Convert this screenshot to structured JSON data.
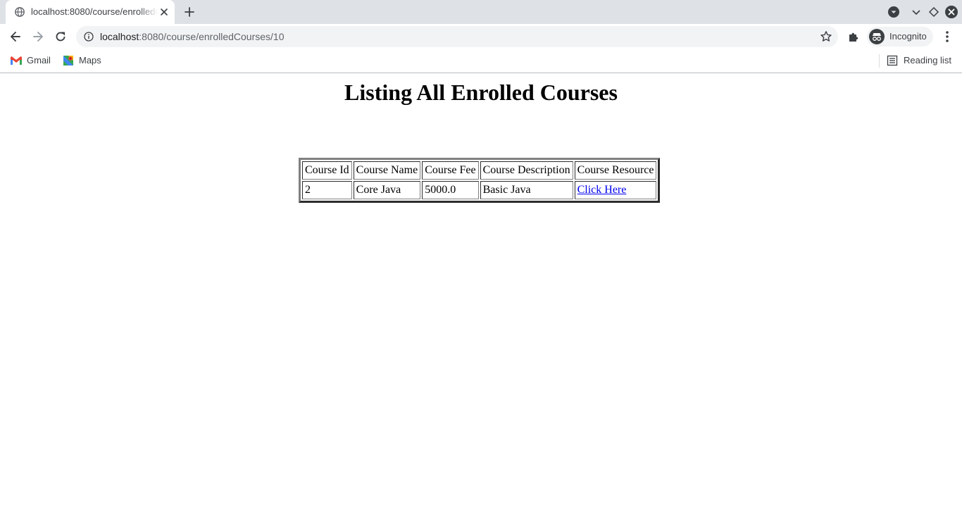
{
  "browser": {
    "tab_title": "localhost:8080/course/enrolledCourses/10",
    "url_host": "localhost",
    "url_path": ":8080/course/enrolledCourses/10",
    "incognito_label": "Incognito",
    "bookmarks": [
      {
        "label": "Gmail",
        "icon": "gmail-icon"
      },
      {
        "label": "Maps",
        "icon": "maps-icon"
      }
    ],
    "reading_list_label": "Reading list"
  },
  "page": {
    "title": "Listing All Enrolled Courses",
    "table": {
      "headers": [
        "Course Id",
        "Course Name",
        "Course Fee",
        "Course Description",
        "Course Resource"
      ],
      "rows": [
        {
          "id": "2",
          "name": "Core Java",
          "fee": "5000.0",
          "description": "Basic Java",
          "resource": "Click Here"
        }
      ]
    }
  },
  "colors": {
    "link": "#0000ee",
    "chrome_background": "#dee1e6"
  }
}
